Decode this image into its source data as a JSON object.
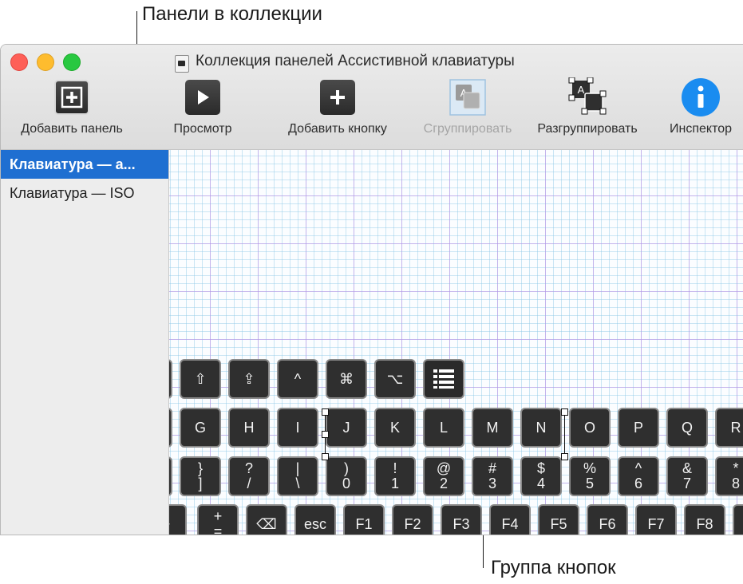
{
  "callouts": {
    "panels": "Панели в коллекции",
    "group": "Группа кнопок"
  },
  "window": {
    "title": "Коллекция панелей Ассистивной клавиатуры"
  },
  "toolbar": {
    "add_panel": "Добавить панель",
    "preview": "Просмотр",
    "add_button": "Добавить кнопку",
    "group": "Сгруппировать",
    "ungroup": "Разгруппировать",
    "inspector": "Инспектор"
  },
  "sidebar": {
    "items": [
      "Клавиатура — а...",
      "Клавиатура — ISO"
    ],
    "selected_index": 0
  },
  "keyboard": {
    "row1": [
      "",
      "⇧",
      "⇪",
      "^",
      "⌘",
      "⌥",
      "list"
    ],
    "row2": [
      "",
      "G",
      "H",
      "I",
      "J",
      "K",
      "L",
      "M",
      "N",
      "O",
      "P",
      "Q",
      "R"
    ],
    "row3": [
      [
        "",
        ""
      ],
      [
        "}",
        "]"
      ],
      [
        "?",
        "/"
      ],
      [
        "|",
        "\\"
      ],
      [
        ")",
        "0"
      ],
      [
        "!",
        "1"
      ],
      [
        "@",
        "2"
      ],
      [
        "#",
        "3"
      ],
      [
        "$",
        "4"
      ],
      [
        "%",
        "5"
      ],
      [
        "^",
        "6"
      ],
      [
        "&",
        "7"
      ],
      [
        "*",
        "8"
      ]
    ],
    "row4": [
      [
        "~",
        ""
      ],
      [
        "+",
        "="
      ],
      [
        "⌫",
        ""
      ],
      [
        "esc",
        ""
      ],
      [
        "F1",
        ""
      ],
      [
        "F2",
        ""
      ],
      [
        "F3",
        ""
      ],
      [
        "F4",
        ""
      ],
      [
        "F5",
        ""
      ],
      [
        "F6",
        ""
      ],
      [
        "F7",
        ""
      ],
      [
        "F8",
        ""
      ],
      [
        "",
        ""
      ]
    ]
  },
  "colors": {
    "selection": "#1f6fd1",
    "key_bg": "#2f2f2f",
    "info": "#1a8cf0"
  }
}
